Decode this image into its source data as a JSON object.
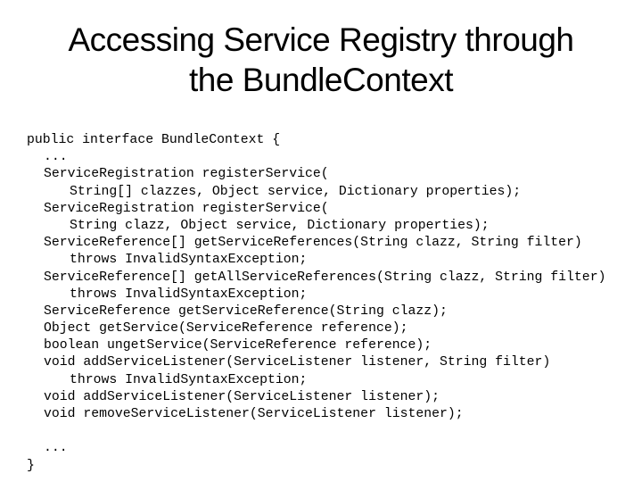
{
  "slide": {
    "title_lines": [
      "Accessing Service Registry through",
      "the BundleContext"
    ],
    "code_lines": [
      {
        "indent": 0,
        "text": "public interface BundleContext {"
      },
      {
        "indent": 1,
        "text": "..."
      },
      {
        "indent": 1,
        "text": "ServiceRegistration registerService("
      },
      {
        "indent": 2,
        "text": "String[] clazzes, Object service, Dictionary properties);"
      },
      {
        "indent": 1,
        "text": "ServiceRegistration registerService("
      },
      {
        "indent": 2,
        "text": "String clazz, Object service, Dictionary properties);"
      },
      {
        "indent": 1,
        "text": "ServiceReference[] getServiceReferences(String clazz, String filter)"
      },
      {
        "indent": 2,
        "text": "throws InvalidSyntaxException;"
      },
      {
        "indent": 1,
        "text": "ServiceReference[] getAllServiceReferences(String clazz, String filter)"
      },
      {
        "indent": 2,
        "text": "throws InvalidSyntaxException;"
      },
      {
        "indent": 1,
        "text": "ServiceReference getServiceReference(String clazz);"
      },
      {
        "indent": 1,
        "text": "Object getService(ServiceReference reference);"
      },
      {
        "indent": 1,
        "text": "boolean ungetService(ServiceReference reference);"
      },
      {
        "indent": 1,
        "text": "void addServiceListener(ServiceListener listener, String filter)"
      },
      {
        "indent": 2,
        "text": "throws InvalidSyntaxException;"
      },
      {
        "indent": 1,
        "text": "void addServiceListener(ServiceListener listener);"
      },
      {
        "indent": 1,
        "text": "void removeServiceListener(ServiceListener listener);"
      },
      {
        "indent": 1,
        "text": ""
      },
      {
        "indent": 1,
        "text": "..."
      },
      {
        "indent": 0,
        "text": "}"
      }
    ]
  }
}
